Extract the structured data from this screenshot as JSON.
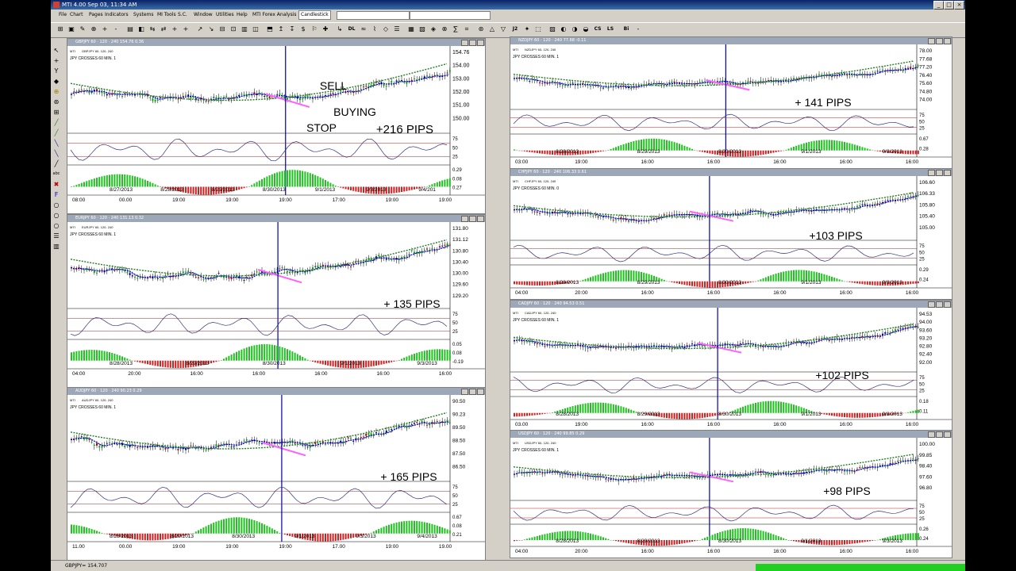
{
  "window": {
    "title": "MTI 4.00 Sep 03, 11:34 AM"
  },
  "menu": [
    "File",
    "Chart",
    "Pages",
    "Indicators",
    "Systems",
    "MI Tools",
    "S.C.",
    "Window",
    "Utilities",
    "Help",
    "MTI Forex Analysis",
    "Candlestick"
  ],
  "status": {
    "quote": "GBPJPY= 154.707"
  },
  "charts": [
    {
      "id": "c1",
      "title": "GBPJPY 60 · 120 · 240 154.76 0.36",
      "sub": "GBPJPY 60- 120- 240",
      "banner": "JPY CROSSES 60 MIN. 1",
      "pips": "+216 PIPS",
      "notes": [
        "SELL",
        "BUYING",
        "STOP"
      ],
      "prices": [
        "154.76",
        "154.00",
        "153.00",
        "152.00",
        "151.00",
        "150.00"
      ],
      "osc": [
        "75",
        "50",
        "25"
      ],
      "hist": [
        "0.29",
        "0.08",
        "0.27"
      ],
      "dates": [
        "8/27/2013",
        "8/28/2013",
        "8/29/2013",
        "8/30/2013",
        "9/1/2013",
        "9/3/2013",
        "9/4/201"
      ],
      "times": [
        "08:00",
        "00.00",
        "19:00",
        "19:00",
        "19:00",
        "17:00",
        "19:00",
        "19:00"
      ]
    },
    {
      "id": "c2",
      "title": "EURJPY 60 · 120 · 240 131.13 0.32",
      "sub": "EURJPY 60- 120- 240",
      "banner": "JPY CROSSES 60 MIN. 1",
      "pips": "+ 135 PIPS",
      "notes": [],
      "prices": [
        "131.80",
        "131.12",
        "130.80",
        "130.40",
        "130.00",
        "129.60",
        "129.20"
      ],
      "osc": [
        "75",
        "50",
        "25"
      ],
      "hist": [
        "0.05",
        "0.08",
        "-0.19"
      ],
      "dates": [
        "8/28/2013",
        "8/29/2013",
        "8/30/2013",
        "9/1/2013",
        "9/3/2013"
      ],
      "times": [
        "04:00",
        "20:00",
        "16:00",
        "16:00",
        "16:00",
        "16:00",
        "16:00"
      ]
    },
    {
      "id": "c3",
      "title": "AUDJPY 60 · 120 · 240 90.23 0.29",
      "sub": "AUDJPY 60- 120- 240",
      "banner": "JPY CROSSES 60 MIN. 1",
      "pips": "+ 165 PIPS",
      "notes": [],
      "prices": [
        "90.50",
        "90.23",
        "89.50",
        "88.50",
        "87.50",
        "86.50"
      ],
      "osc": [
        "75",
        "50",
        "25"
      ],
      "hist": [
        "0.67",
        "0.08",
        "0.21"
      ],
      "dates": [
        "8/28/2013",
        "8/29/2013",
        "8/30/2013",
        "9/1/2013",
        "9/3/2013",
        "9/4/2013"
      ],
      "times": [
        "11.00",
        "00.00",
        "19:00",
        "19:00",
        "19:00",
        "17.00",
        "19:00",
        "19.00"
      ]
    },
    {
      "id": "c4",
      "title": "NZDJPY 60 · 120 · 240 77.68 -0.11",
      "sub": "NZDJPY 60- 120- 240",
      "banner": "JPY CROSSES 60 MIN. 1",
      "pips": "+ 141 PIPS",
      "notes": [],
      "prices": [
        "78.00",
        "77.68",
        "77.20",
        "76.40",
        "75.60",
        "74.80",
        "74.00"
      ],
      "osc": [
        "75",
        "50",
        "25"
      ],
      "hist": [
        "0.67",
        "0.28"
      ],
      "dates": [
        "8/28/2013",
        "8/29/2013",
        "8/30/2013",
        "9/1/2013",
        "9/3/2013"
      ],
      "times": [
        "03:00",
        "19:00",
        "16:00",
        "16:00",
        "16:00",
        "16:00",
        "16:00"
      ]
    },
    {
      "id": "c5",
      "title": "CHFJPY 60 · 120 · 240 106.33 0.61",
      "sub": "CHFJPY 60- 120- 240",
      "banner": "JPY CROSSES 60 MIN. 0",
      "pips": "+103 PIPS",
      "notes": [],
      "prices": [
        "106.60",
        "106.33",
        "105.80",
        "105.40",
        "105.00"
      ],
      "osc": [
        "75",
        "50",
        "25"
      ],
      "hist": [
        "0.29",
        "0.24"
      ],
      "dates": [
        "8/28/2013",
        "8/29/2013",
        "8/30/2013",
        "9/1/2013",
        "9/3/2013"
      ],
      "times": [
        "04:00",
        "20:00",
        "16:00",
        "16:00",
        "16:00",
        "16:00",
        "16:00"
      ]
    },
    {
      "id": "c6",
      "title": "CADJPY 60 · 120 · 240 94.53 0.51",
      "sub": "CADJPY 60- 120- 240",
      "banner": "JPY CROSSES 60 MIN. 1",
      "pips": "+102 PIPS",
      "notes": [],
      "prices": [
        "94.53",
        "94.00",
        "93.60",
        "93.20",
        "92.80",
        "92.40",
        "92.00"
      ],
      "osc": [
        "75",
        "50",
        "25"
      ],
      "hist": [
        "0.18",
        "0.11"
      ],
      "dates": [
        "8/28/2013",
        "8/29/2013",
        "8/30/2013",
        "9/1/2013",
        "9/3/2013"
      ],
      "times": [
        "03.00",
        "19:00",
        "16:00",
        "16:00",
        "16:00",
        "16:00",
        "16:00"
      ]
    },
    {
      "id": "c7",
      "title": "USDJPY 60 · 120 · 240 99.85 0.29",
      "sub": "USDJPY 60- 120- 240",
      "banner": "JPY CROSSES 60 MIN. 1",
      "pips": "+98 PIPS",
      "notes": [],
      "prices": [
        "100.00",
        "99.85",
        "98.40",
        "97.60",
        "96.80"
      ],
      "osc": [
        "75",
        "50",
        "25"
      ],
      "hist": [
        "0.26",
        "0.24"
      ],
      "dates": [
        "8/28/2013",
        "8/29/2013",
        "8/30/2013",
        "9/1/2013",
        "9/3/2013"
      ],
      "times": [
        "04:00",
        "20:00",
        "16:00",
        "16:00",
        "16:00",
        "16:00",
        "16:00"
      ]
    }
  ]
}
